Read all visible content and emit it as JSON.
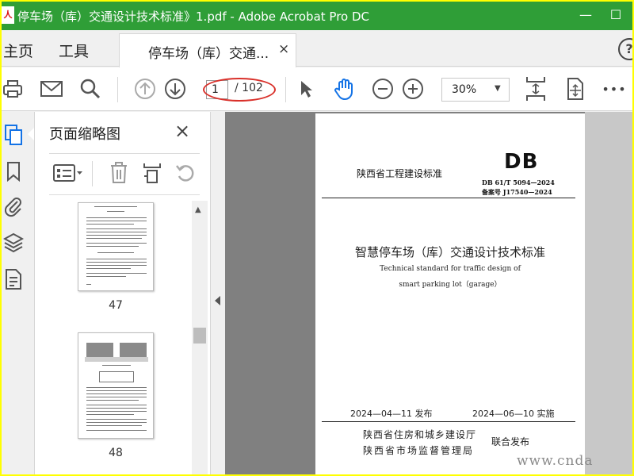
{
  "window": {
    "title": "停车场（库）交通设计技术标准》1.pdf - Adobe Acrobat Pro DC",
    "minimize": "—",
    "maximize": "☐",
    "app_icon": "人"
  },
  "tabs": {
    "home": "主页",
    "tools": "工具",
    "document": "停车场（库）交通...",
    "close": "×",
    "help": "?"
  },
  "toolbar": {
    "page_current": "1",
    "page_total": "/ 102",
    "zoom": "30%",
    "more": "•••"
  },
  "thumbnail_panel": {
    "title": "页面缩略图",
    "close": "×",
    "pages": [
      {
        "label": "47"
      },
      {
        "label": "48"
      }
    ]
  },
  "document_page": {
    "province_standard": "陕西省工程建设标准",
    "db_logo": "DB",
    "standard_number": "DB  61/T  5094—2024",
    "record_number": "备案号   J17540—2024",
    "title_cn": "智慧停车场（库）交通设计技术标准",
    "title_en_line1": "Technical standard for traffic design of",
    "title_en_line2": "smart parking lot（garage）",
    "release_date": "2024—04—11 发布",
    "implement_date": "2024—06—10 实施",
    "issuer_1": "陕西省住房和城乡建设厅",
    "issuer_2": "陕西省市场监督管理局",
    "joint_release": "联合发布"
  },
  "watermark": "www.cnda",
  "colors": {
    "titlebar": "#2f9e37",
    "border_highlight": "#ffff00",
    "annotation_ellipse": "#d9302a",
    "hand_tool_accent": "#1473e6"
  }
}
